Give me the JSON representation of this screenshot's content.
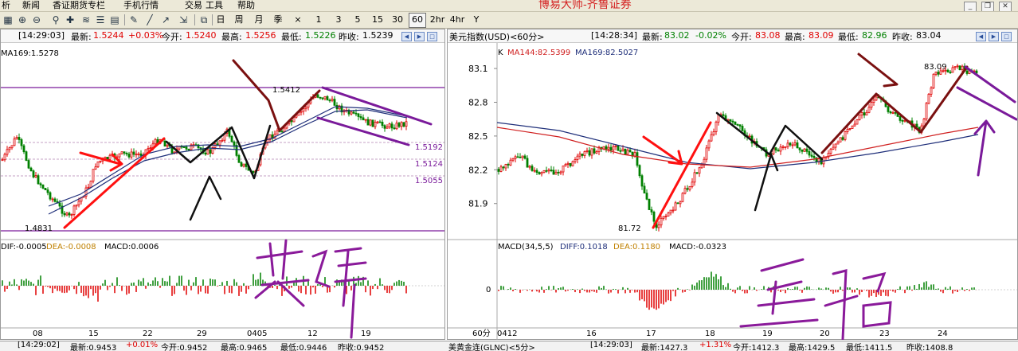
{
  "menu": {
    "items": [
      "析",
      "新闻",
      "香证期货专栏",
      "手机行情",
      "交易",
      "工具",
      "帮助"
    ],
    "brand_text": "博易大师-齐鲁证券"
  },
  "toolbar": {
    "periods": [
      "日",
      "周",
      "月",
      "季",
      "×",
      "1",
      "3",
      "5",
      "15",
      "30",
      "60",
      "2hr",
      "4hr",
      "Y"
    ],
    "active_period": "60"
  },
  "left_panel": {
    "header": {
      "time": "[14:29:03]",
      "last_label": "最新:",
      "last": "1.5244",
      "change": "+0.03%",
      "open_label": "今开:",
      "open": "1.5240",
      "high_label": "最高:",
      "high": "1.5256",
      "low_label": "最低:",
      "low": "1.5226",
      "prev_label": "昨收:",
      "prev": "1.5239"
    },
    "ma_label": "MA169:1.5278",
    "price_labels": [
      "1.5192",
      "1.5124",
      "1.5055"
    ],
    "high_annotation": "1.5412",
    "low_annotation": "1.4831",
    "macd_header": {
      "dif": "DIF:-0.0005",
      "dea": "DEA:-0.0008",
      "macd": "MACD:0.0006"
    },
    "x_ticks": [
      "08",
      "15",
      "22",
      "29",
      "0405",
      "12",
      "19"
    ],
    "handwriting": "英镑"
  },
  "right_panel": {
    "header": {
      "symbol": "美元指数(USD)<60分>",
      "time": "[14:28:34]",
      "last_label": "最新:",
      "last": "83.02",
      "change": "-0.02%",
      "open_label": "今开:",
      "open": "83.08",
      "high_label": "最高:",
      "high": "83.09",
      "low_label": "最低:",
      "low": "82.96",
      "prev_label": "昨收:",
      "prev": "83.04"
    },
    "ma_label": {
      "k": "K",
      "ma144": "MA144:82.5399",
      "ma169": "MA169:82.5027"
    },
    "high_annotation": "83.09",
    "low_annotation": "81.72",
    "macd_header": {
      "name": "MACD(34,5,5)",
      "dif": "DIFF:0.1018",
      "dea": "DEA:0.1180",
      "macd": "MACD:-0.0323"
    },
    "macd_zero_label": "0",
    "period_label": "60分",
    "x_ticks": [
      "0412",
      "16",
      "17",
      "18",
      "19",
      "20",
      "23",
      "24"
    ],
    "handwriting": "美指"
  },
  "bottom_strip": {
    "left": [
      "[14:29:02]",
      "最新:0.9453",
      "+0.01%",
      "今开:0.9452",
      "最高:0.9465",
      "最低:0.9446",
      "昨收:0.9452"
    ],
    "right_symbol": "美黄金连(GLNC)<5分>",
    "right": [
      "[14:29:03]",
      "最新:1427.3",
      "+1.31%",
      "今开:1412.3",
      "最高:1429.5",
      "最低:1411.5",
      "昨收:1408.8"
    ]
  },
  "colors": {
    "up": "#e00000",
    "down": "#008000",
    "ma_dark": "#1f2f7a",
    "ma_red": "#d02020",
    "annot_purple": "#7a1a9a",
    "annot_red": "#ff1010",
    "annot_brown": "#7a1010"
  },
  "chart_data": [
    {
      "type": "candlestick",
      "title": "",
      "ylim": [
        1.48,
        1.545
      ],
      "y_labels": [
        1.5192,
        1.5124,
        1.5055
      ],
      "x_ticks": [
        "08",
        "15",
        "22",
        "29",
        "0405",
        "12",
        "19"
      ],
      "indicators": [
        "MA169:1.5278"
      ],
      "annotations": [
        {
          "text": "1.5412",
          "type": "high"
        },
        {
          "text": "1.4831",
          "type": "low"
        }
      ]
    },
    {
      "type": "candlestick",
      "title": "美元指数(USD)<60分>",
      "ylim": [
        81.7,
        83.15
      ],
      "y_ticks": [
        81.9,
        82.2,
        82.5,
        82.8,
        83.1
      ],
      "x_ticks": [
        "0412",
        "16",
        "17",
        "18",
        "19",
        "20",
        "23",
        "24"
      ],
      "indicators": [
        "MA144:82.5399",
        "MA169:82.5027"
      ],
      "annotations": [
        {
          "text": "83.09",
          "type": "high"
        },
        {
          "text": "81.72",
          "type": "low"
        }
      ]
    }
  ]
}
